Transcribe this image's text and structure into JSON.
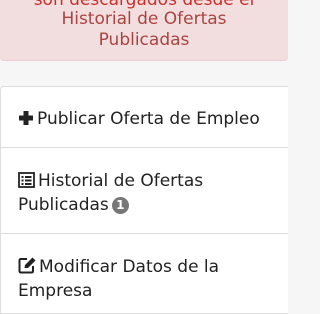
{
  "alert": {
    "line1": "son descargados desde el",
    "line2": "Historial de Ofertas",
    "line3": "Publicadas"
  },
  "menu": {
    "items": [
      {
        "icon": "plus-icon",
        "label": "Publicar Oferta de Empleo"
      },
      {
        "icon": "list-icon",
        "label_line1": "Historial de Ofertas",
        "label_line2": "Publicadas",
        "badge": "1"
      },
      {
        "icon": "edit-icon",
        "label_line1": "Modificar Datos de la",
        "label_line2": "Empresa"
      }
    ]
  },
  "colors": {
    "alert_bg": "#f2dede",
    "alert_text": "#a94442",
    "badge_bg": "#777777"
  }
}
